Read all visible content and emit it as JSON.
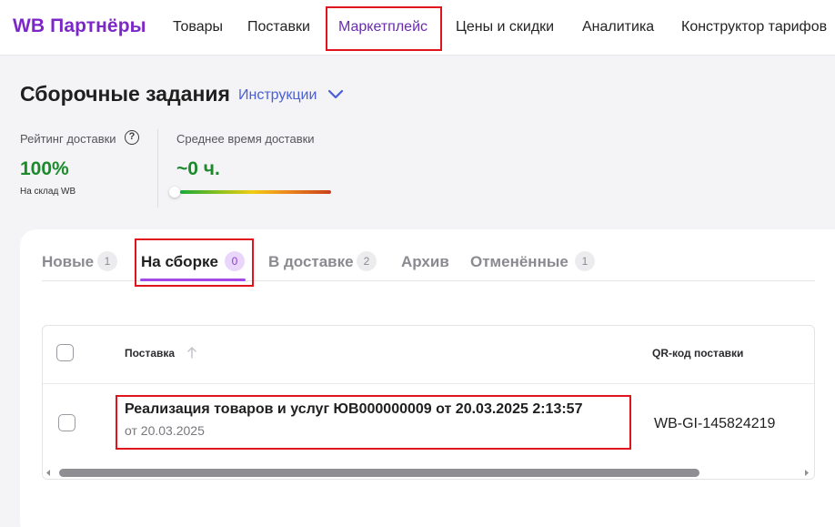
{
  "header": {
    "logo": "WB Партнёры",
    "nav": [
      "Товары",
      "Поставки",
      "Маркетплейс",
      "Цены и скидки",
      "Аналитика",
      "Конструктор тарифов"
    ],
    "active_nav": "Маркетплейс"
  },
  "page": {
    "title": "Сборочные задания",
    "instructions_link": "Инструкции"
  },
  "metrics": {
    "rating": {
      "label": "Рейтинг доставки",
      "value": "100%",
      "sub": "На склад WB",
      "value_color": "#1a8a2a"
    },
    "avg_time": {
      "label": "Среднее время доставки",
      "value": "~0 ч.",
      "value_color": "#1a8a2a"
    }
  },
  "tabs": [
    {
      "label": "Новые",
      "count": "1"
    },
    {
      "label": "На сборке",
      "count": "0",
      "active": true
    },
    {
      "label": "В доставке",
      "count": "2"
    },
    {
      "label": "Архив"
    },
    {
      "label": "Отменённые",
      "count": "1"
    }
  ],
  "table": {
    "columns": [
      "Поставка",
      "QR-код поставки"
    ],
    "rows": [
      {
        "title": "Реализация товаров и услуг ЮВ000000009 от 20.03.2025 2:13:57",
        "date": "от 20.03.2025",
        "qr": "WB-GI-145824219"
      }
    ]
  },
  "colors": {
    "brand": "#7d27c9",
    "link": "#4a5fd6",
    "highlight": "#e0141c",
    "accent": "#a449e6"
  }
}
